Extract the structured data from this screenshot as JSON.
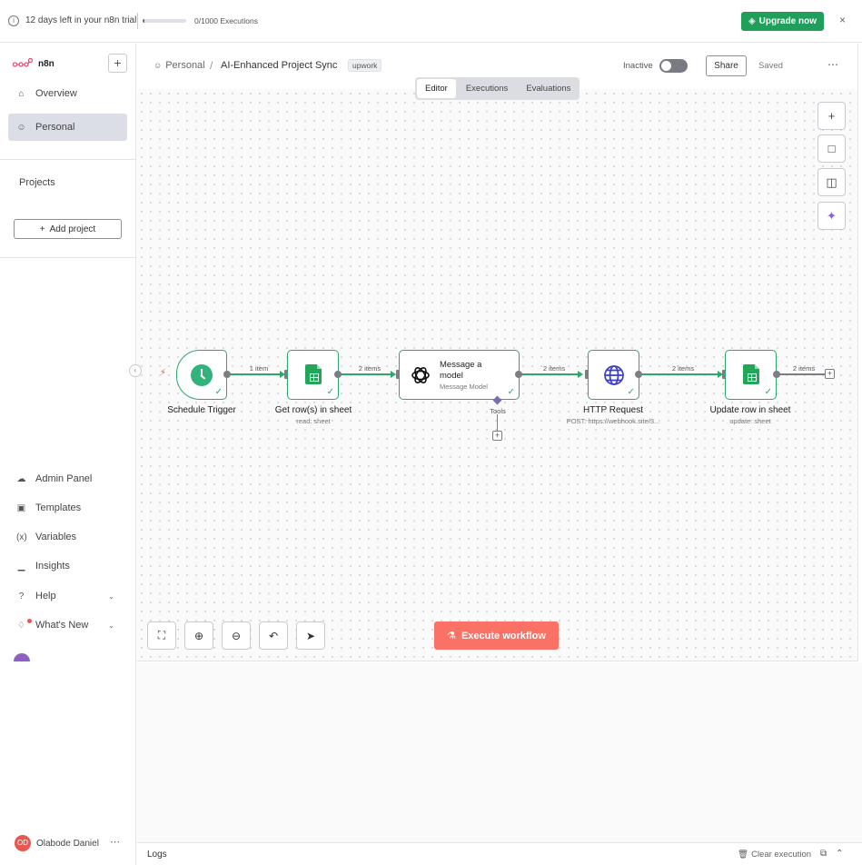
{
  "banner": {
    "trial_text": "12 days left in your n8n trial",
    "executions_text": "0/1000 Executions",
    "executions_progress": 0.05,
    "upgrade_label": "Upgrade now",
    "close_glyph": "×"
  },
  "sidebar": {
    "brand": "n8n",
    "add_glyph": "+",
    "top_items": [
      {
        "label": "Overview",
        "icon": "home-icon"
      },
      {
        "label": "Personal",
        "icon": "user-icon"
      }
    ],
    "projects_label": "Projects",
    "add_project_label": "Add project",
    "bottom_items": [
      {
        "label": "Admin Panel",
        "icon": "cloud-icon"
      },
      {
        "label": "Templates",
        "icon": "box-icon"
      },
      {
        "label": "Variables",
        "icon": "variable-icon"
      },
      {
        "label": "Insights",
        "icon": "bar-chart-icon"
      },
      {
        "label": "Help",
        "icon": "help-icon"
      },
      {
        "label": "What's New",
        "icon": "bell-icon"
      }
    ],
    "user_name": "Olabode Daniel",
    "user_initials": "OD"
  },
  "header": {
    "breadcrumb_personal": "Personal",
    "workflow_title": "AI-Enhanced Project Sync",
    "tag": "upwork",
    "status_label": "Inactive",
    "share_label": "Share",
    "saved_label": "Saved"
  },
  "tabs": [
    "Editor",
    "Executions",
    "Evaluations"
  ],
  "canvas": {
    "execute_label": "Execute workflow",
    "nodes": [
      {
        "title": "Schedule Trigger",
        "subtitle": ""
      },
      {
        "title": "Get row(s) in sheet",
        "subtitle": "read: sheet"
      },
      {
        "title": "Message a model",
        "subtitle": "Message Model",
        "title_line1": "Message a",
        "title_line2": "model"
      },
      {
        "title": "HTTP Request",
        "subtitle": "POST: https://webhook.site/3..."
      },
      {
        "title": "Update row in sheet",
        "subtitle": "update: sheet"
      }
    ],
    "connections": [
      "1 item",
      "2 items",
      "2 items",
      "2 items",
      "2 items"
    ],
    "tools_label": "Tools"
  },
  "logs": {
    "label": "Logs",
    "clear_label": "Clear execution"
  },
  "colors": {
    "accent_green": "#1f9f5a",
    "execute": "#fa7165",
    "node_border": "#2ea76d"
  }
}
